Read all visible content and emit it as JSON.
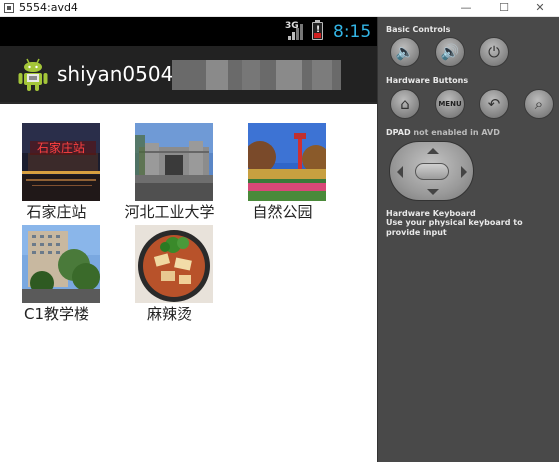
{
  "window": {
    "title": "5554:avd4",
    "minimize_glyph": "—",
    "maximize_glyph": "☐",
    "close_glyph": "✕"
  },
  "status_bar": {
    "network": "3G",
    "time": "8:15",
    "battery_glyph": "!"
  },
  "action_bar": {
    "app_icon": "android-icon",
    "title": "shiyan0504_"
  },
  "grid": {
    "items": [
      {
        "label": "石家庄站"
      },
      {
        "label": "河北工业大学"
      },
      {
        "label": "自然公园"
      },
      {
        "label": "C1教学楼"
      },
      {
        "label": "麻辣烫"
      }
    ]
  },
  "controls": {
    "basic_controls_label": "Basic Controls",
    "hardware_buttons_label": "Hardware Buttons",
    "dpad_label": "DPAD",
    "dpad_note": "not enabled in AVD",
    "keyboard_label": "Hardware Keyboard",
    "keyboard_note": "Use your physical keyboard to provide input",
    "menu_label": "MENU"
  }
}
